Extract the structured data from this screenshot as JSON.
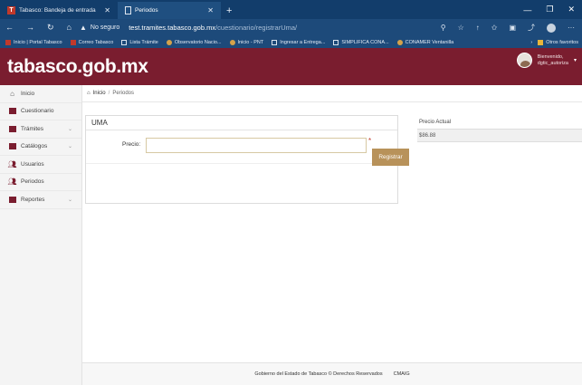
{
  "browser": {
    "tabs": [
      {
        "label": "Tabasco: Bandeja de entrada",
        "icon": "tabasco-logo-icon"
      },
      {
        "label": "Periodos",
        "icon": "document-icon"
      }
    ],
    "address": {
      "security": "No seguro",
      "host": "test.tramites.tabasco.gob.mx",
      "path": "/cuestionario/registrarUma/"
    },
    "bookmarks": [
      {
        "label": "Inicio | Portal Tabasco",
        "icon": "tabasco-logo-icon"
      },
      {
        "label": "Correo Tabasco",
        "icon": "tabasco-logo-icon"
      },
      {
        "label": "Lista Trámite",
        "icon": "document-icon"
      },
      {
        "label": "Observatorio Nacio...",
        "icon": "globe-icon"
      },
      {
        "label": "Inicio - PNT",
        "icon": "pnt-icon"
      },
      {
        "label": "Ingresar a Entrega...",
        "icon": "document-icon"
      },
      {
        "label": "SIMPLIFICA CONA...",
        "icon": "document-icon"
      },
      {
        "label": "CONAMER Ventanilla",
        "icon": "conamer-icon"
      }
    ],
    "other_favorites": "Otros favoritos"
  },
  "header": {
    "brand": "tabasco.gob.mx",
    "welcome": "Bienvenido,",
    "username": "dgtic_autoriza"
  },
  "sidebar": {
    "items": [
      {
        "label": "Inicio",
        "icon": "home-icon",
        "has_chevron": false
      },
      {
        "label": "Cuestionario",
        "icon": "form-icon",
        "has_chevron": false
      },
      {
        "label": "Trámites",
        "icon": "folder-icon",
        "has_chevron": true
      },
      {
        "label": "Catálogos",
        "icon": "folder-icon",
        "has_chevron": true
      },
      {
        "label": "Usuarios",
        "icon": "users-icon",
        "has_chevron": false
      },
      {
        "label": "Periodos",
        "icon": "users-icon",
        "has_chevron": false
      },
      {
        "label": "Reportes",
        "icon": "folder-icon",
        "has_chevron": true
      }
    ]
  },
  "breadcrumb": {
    "home": "Inicio",
    "separator": "/",
    "current": "Periodos"
  },
  "form": {
    "title": "UMA",
    "price_label": "Precio:",
    "price_value": "",
    "required_mark": "*",
    "submit_label": "Registrar"
  },
  "current_price": {
    "header": "Precio Actual",
    "value": "$86.88"
  },
  "footer": {
    "text": "Gobierno del Estado de Tabasco © Derechos Reservados",
    "org": "CMAIG"
  },
  "colors": {
    "brand": "#7a1d2f",
    "button": "#b8925a",
    "browser_chrome": "#1d4a7a"
  }
}
